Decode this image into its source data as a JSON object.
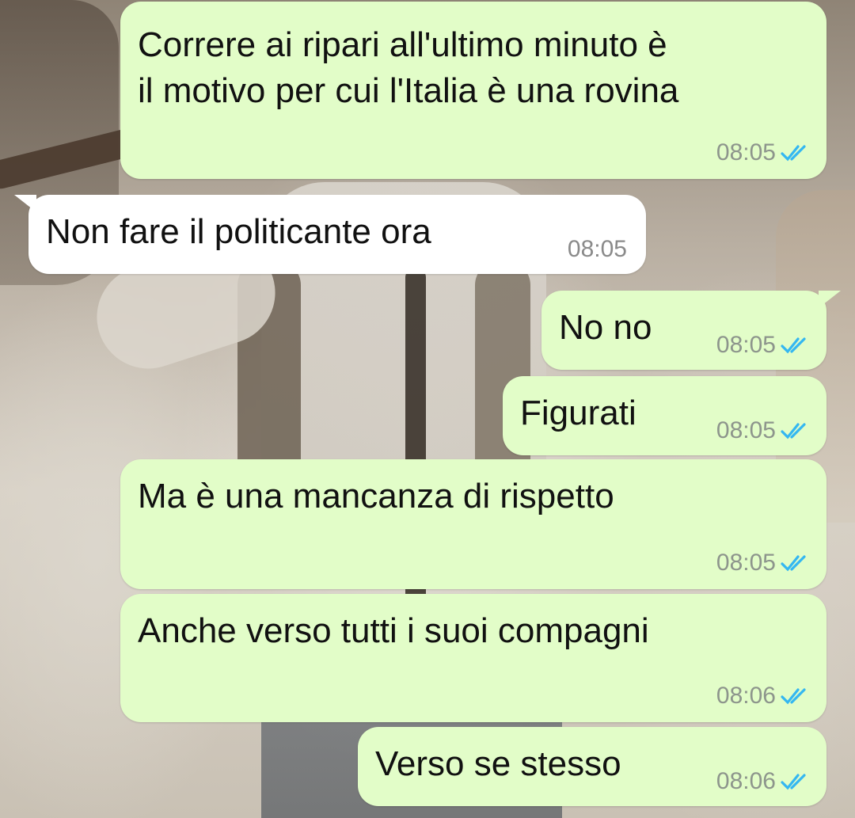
{
  "colors": {
    "outgoing_bubble": "#e2fdc8",
    "incoming_bubble": "#ffffff",
    "read_tick": "#34b7f1",
    "timestamp": "#8d958c"
  },
  "messages": [
    {
      "direction": "outgoing",
      "text_lines": [
        "Correre ai ripari all'ultimo minuto è",
        "il motivo per cui l'Italia è una rovina"
      ],
      "time": "08:05",
      "status_icon": "double-check-read-icon"
    },
    {
      "direction": "incoming",
      "text_lines": [
        "Non fare il politicante ora"
      ],
      "time": "08:05"
    },
    {
      "direction": "outgoing",
      "text_lines": [
        "No no"
      ],
      "time": "08:05",
      "status_icon": "double-check-read-icon"
    },
    {
      "direction": "outgoing",
      "text_lines": [
        "Figurati"
      ],
      "time": "08:05",
      "status_icon": "double-check-read-icon"
    },
    {
      "direction": "outgoing",
      "text_lines": [
        "Ma è una mancanza di rispetto"
      ],
      "time": "08:05",
      "status_icon": "double-check-read-icon"
    },
    {
      "direction": "outgoing",
      "text_lines": [
        "Anche verso tutti i suoi compagni"
      ],
      "time": "08:06",
      "status_icon": "double-check-read-icon"
    },
    {
      "direction": "outgoing",
      "text_lines": [
        "Verso se stesso"
      ],
      "time": "08:06",
      "status_icon": "double-check-read-icon"
    }
  ]
}
